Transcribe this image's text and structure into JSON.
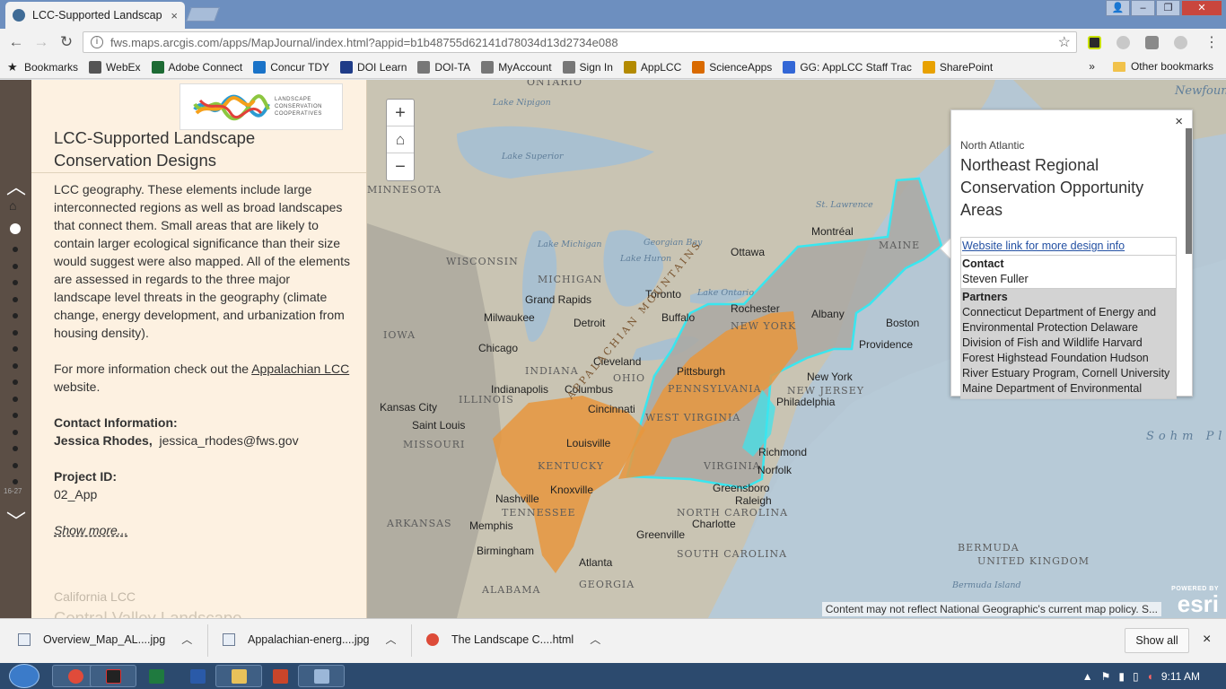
{
  "browser": {
    "tab_title": "LCC-Supported Landscap",
    "tab_close": "×",
    "url": "fws.maps.arcgis.com/apps/MapJournal/index.html?appid=b1b48755d62141d78034d13d2734e088"
  },
  "bookmarks": {
    "items": [
      {
        "label": "Bookmarks",
        "icon": "star-icon",
        "color": "#444444"
      },
      {
        "label": "WebEx",
        "icon": "webex-icon",
        "color": "#555555"
      },
      {
        "label": "Adobe Connect",
        "icon": "adobe-connect-icon",
        "color": "#1d6b34"
      },
      {
        "label": "Concur TDY",
        "icon": "concur-icon",
        "color": "#1a73c8"
      },
      {
        "label": "DOI Learn",
        "icon": "doi-learn-icon",
        "color": "#1f3c88"
      },
      {
        "label": "DOI-TA",
        "icon": "page-icon",
        "color": "#777777"
      },
      {
        "label": "MyAccount",
        "icon": "page-icon",
        "color": "#777777"
      },
      {
        "label": "Sign In",
        "icon": "page-icon",
        "color": "#777777"
      },
      {
        "label": "AppLCC",
        "icon": "applcc-icon",
        "color": "#b38a00"
      },
      {
        "label": "ScienceApps",
        "icon": "scienceapps-icon",
        "color": "#d96a00"
      },
      {
        "label": "GG: AppLCC Staff Trac",
        "icon": "google-icon",
        "color": "#3367d6"
      },
      {
        "label": "SharePoint",
        "icon": "sharepoint-icon",
        "color": "#e8a100"
      }
    ],
    "overflow": "»",
    "other": "Other bookmarks"
  },
  "panel": {
    "title": "LCC-Supported Landscape Conservation Designs",
    "logo_text": [
      "LANDSCAPE",
      "CONSERVATION",
      "COOPERATIVES"
    ],
    "para1": "LCC geography. These elements include large interconnected regions as well as broad landscapes that connect them. Small areas that are likely to contain larger ecological significance than their size would suggest were also mapped. All of the elements are assessed in regards to the three major landscape level threats in the geography (climate change, energy development, and urbanization from housing density).",
    "more_info_prefix": "For more information check out the ",
    "more_info_link": "Appalachian LCC",
    "more_info_suffix": " website.",
    "contact_label": "Contact Information:",
    "contact_name": "Jessica Rhodes,",
    "contact_email": "jessica_rhodes@fws.gov",
    "project_label": "Project ID:",
    "project_id": "02_App",
    "show_more": "Show more...",
    "next_region": "California LCC",
    "next_title": "Central Valley Landscape"
  },
  "dotnav": {
    "counter": "16-27"
  },
  "map": {
    "zoom_in": "+",
    "zoom_out": "−",
    "labels": [
      {
        "text": "ONTARIO",
        "cls": "state"
      },
      {
        "text": "Lake Nipigon",
        "cls": "water"
      },
      {
        "text": "Lake Superior",
        "cls": "water"
      },
      {
        "text": "MINNESOTA",
        "cls": "state"
      },
      {
        "text": "WISCONSIN",
        "cls": "state"
      },
      {
        "text": "MICHIGAN",
        "cls": "state"
      },
      {
        "text": "Lake Michigan",
        "cls": "water"
      },
      {
        "text": "Lake Huron",
        "cls": "water"
      },
      {
        "text": "Georgian Bay",
        "cls": "water"
      },
      {
        "text": "Ottawa",
        "cls": "city"
      },
      {
        "text": "Montréal",
        "cls": "city"
      },
      {
        "text": "St. Lawrence",
        "cls": "water"
      },
      {
        "text": "MAINE",
        "cls": "state"
      },
      {
        "text": "Grand Rapids",
        "cls": "city"
      },
      {
        "text": "Toronto",
        "cls": "city"
      },
      {
        "text": "Lake Ontario",
        "cls": "water"
      },
      {
        "text": "Milwaukee",
        "cls": "city"
      },
      {
        "text": "Detroit",
        "cls": "city"
      },
      {
        "text": "Buffalo",
        "cls": "city"
      },
      {
        "text": "Rochester",
        "cls": "city"
      },
      {
        "text": "Albany",
        "cls": "city"
      },
      {
        "text": "NEW YORK",
        "cls": "state"
      },
      {
        "text": "Boston",
        "cls": "city"
      },
      {
        "text": "Providence",
        "cls": "city"
      },
      {
        "text": "IOWA",
        "cls": "state"
      },
      {
        "text": "Chicago",
        "cls": "city"
      },
      {
        "text": "Cleveland",
        "cls": "city"
      },
      {
        "text": "Pittsburgh",
        "cls": "city"
      },
      {
        "text": "INDIANA",
        "cls": "state"
      },
      {
        "text": "OHIO",
        "cls": "state"
      },
      {
        "text": "PENNSYLVANIA",
        "cls": "state"
      },
      {
        "text": "New York",
        "cls": "city"
      },
      {
        "text": "NEW JERSEY",
        "cls": "state"
      },
      {
        "text": "Philadelphia",
        "cls": "city"
      },
      {
        "text": "Indianapolis",
        "cls": "city"
      },
      {
        "text": "Columbus",
        "cls": "city"
      },
      {
        "text": "ILLINOIS",
        "cls": "state"
      },
      {
        "text": "Kansas City",
        "cls": "city"
      },
      {
        "text": "Cincinnati",
        "cls": "city"
      },
      {
        "text": "WEST VIRGINIA",
        "cls": "state"
      },
      {
        "text": "Saint Louis",
        "cls": "city"
      },
      {
        "text": "MISSOURI",
        "cls": "state"
      },
      {
        "text": "Louisville",
        "cls": "city"
      },
      {
        "text": "Richmond",
        "cls": "city"
      },
      {
        "text": "KENTUCKY",
        "cls": "state"
      },
      {
        "text": "VIRGINIA",
        "cls": "state"
      },
      {
        "text": "Norfolk",
        "cls": "city"
      },
      {
        "text": "Nashville",
        "cls": "city"
      },
      {
        "text": "Knoxville",
        "cls": "city"
      },
      {
        "text": "TENNESSEE",
        "cls": "state"
      },
      {
        "text": "Greensboro",
        "cls": "city"
      },
      {
        "text": "Raleigh",
        "cls": "city"
      },
      {
        "text": "NORTH CAROLINA",
        "cls": "state"
      },
      {
        "text": "ARKANSAS",
        "cls": "state"
      },
      {
        "text": "Memphis",
        "cls": "city"
      },
      {
        "text": "Charlotte",
        "cls": "city"
      },
      {
        "text": "Greenville",
        "cls": "city"
      },
      {
        "text": "Birmingham",
        "cls": "city"
      },
      {
        "text": "Atlanta",
        "cls": "city"
      },
      {
        "text": "SOUTH CAROLINA",
        "cls": "state"
      },
      {
        "text": "ALABAMA",
        "cls": "state"
      },
      {
        "text": "GEORGIA",
        "cls": "state"
      },
      {
        "text": "BERMUDA",
        "cls": "state"
      },
      {
        "text": "UNITED KINGDOM",
        "cls": "state"
      },
      {
        "text": "Bermuda Island",
        "cls": "water"
      },
      {
        "text": "Sohm Plain",
        "cls": "water"
      },
      {
        "text": "Newfoundland",
        "cls": "water"
      },
      {
        "text": "APPALACHIAN MOUNTAINS",
        "cls": "state"
      }
    ],
    "attribution": "Content may not reflect National Geographic's current map policy. S...",
    "esri_powered": "POWERED BY",
    "esri": "esri",
    "colors": {
      "appalachian": "#e8963d",
      "north_atlantic_outline": "#39e6ef"
    }
  },
  "popup": {
    "close": "×",
    "region": "North Atlantic",
    "title": "Northeast Regional Conservation Opportunity Areas",
    "link": "Website link for more design info",
    "contact_label": "Contact",
    "contact_name": "Steven Fuller",
    "partners_label": "Partners",
    "partners_text": "Connecticut Department of Energy and Environmental Protection Delaware Division of Fish and Wildlife Harvard Forest Highstead Foundation Hudson River Estuary Program, Cornell University Maine Department of Environmental Protection Maine"
  },
  "downloads": {
    "items": [
      {
        "label": "Overview_Map_AL....jpg"
      },
      {
        "label": "Appalachian-energ....jpg"
      },
      {
        "label": "The Landscape C....html"
      }
    ],
    "show_all": "Show all",
    "close": "×"
  },
  "taskbar": {
    "time": "9:11 AM"
  }
}
